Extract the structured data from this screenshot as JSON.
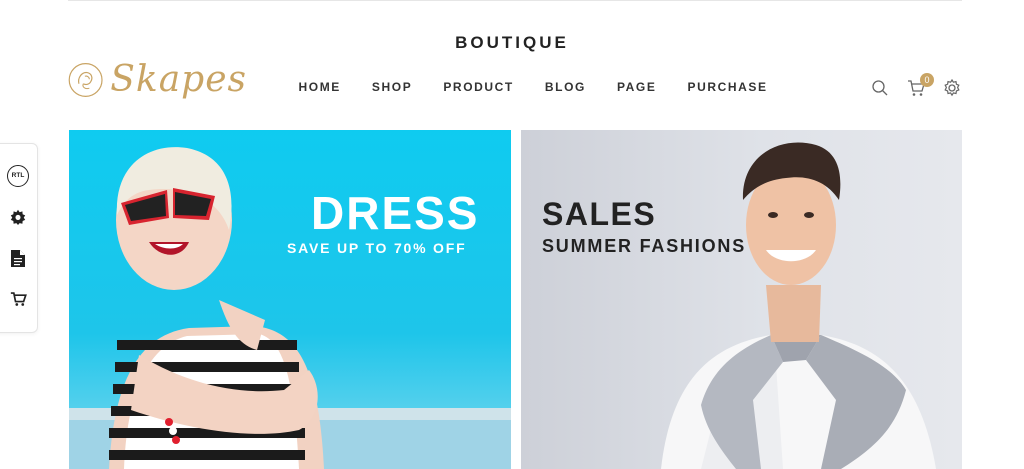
{
  "header": {
    "site_title": "BOUTIQUE",
    "logo_text": "Skapes",
    "nav": [
      "HOME",
      "SHOP",
      "PRODUCT",
      "BLOG",
      "PAGE",
      "PURCHASE"
    ],
    "icons": [
      "search-icon",
      "cart-icon",
      "gear-icon"
    ],
    "cart_count": "0"
  },
  "sidebar": {
    "rtl_label": "RTL",
    "icons": [
      "rtl-icon",
      "gear-icon",
      "document-icon",
      "cart-icon"
    ]
  },
  "banners": {
    "left": {
      "title": "DRESS",
      "subtitle": "SAVE UP TO 70% OFF"
    },
    "right": {
      "title": "SALES",
      "subtitle": "SUMMER FASHIONS"
    }
  },
  "colors": {
    "accent": "#c9a464",
    "left_banner_bg": "#0fcbf0",
    "right_banner_bg": "#dfe2e8",
    "text": "#222222"
  }
}
